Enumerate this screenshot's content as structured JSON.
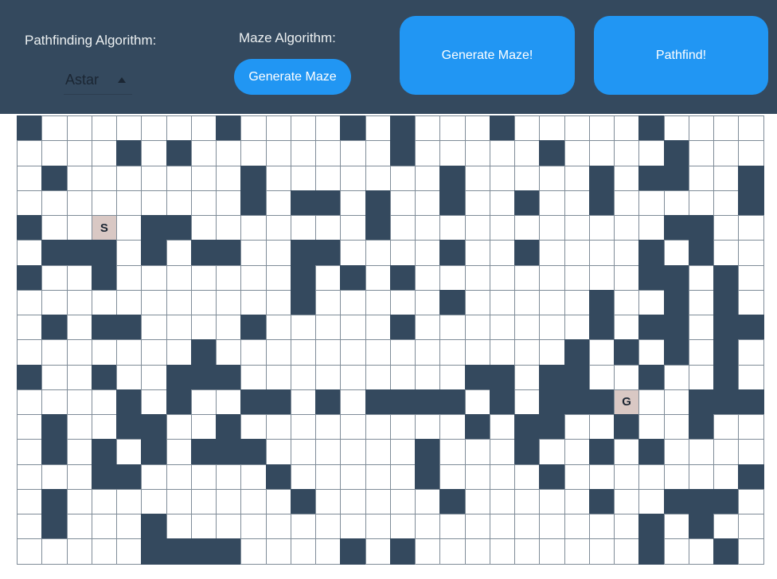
{
  "controls": {
    "pathfinding_label": "Pathfinding Algorithm:",
    "pathfinding_selected": "Astar",
    "maze_label": "Maze Algorithm:",
    "maze_button": "Generate Maze",
    "generate_button": "Generate Maze!",
    "pathfind_button": "Pathfind!"
  },
  "grid": {
    "cols": 30,
    "rows": 18,
    "start_label": "S",
    "goal_label": "G",
    "start": [
      3,
      4
    ],
    "goal": [
      24,
      11
    ],
    "walls": [
      "#.......#....#.#...#.....#....",
      "....#.#........#.....#....#...",
      ".#.......#.......#.....#.##..#",
      ".........#.##.#..#..#..#.....#",
      "#....##.......#...........##..",
      ".###.#.##..##....#..#....#.#..",
      "#..#.......#.#.#.........##.#.",
      "...........#.....#.....#..#.#.",
      ".#.##....#.....#.......#.##.##",
      ".......#..............#.#.#.#.",
      "#..#..###.........##.##..#..#.",
      "....#.#..##.#.####.#.###...###",
      ".#..##..#.........#.##..#..#..",
      ".#.#.#.###......#...#..#.#....",
      "...##.....#.....#....#.......#",
      ".#.........#.....#.....#..###.",
      ".#...#...................#.#..",
      ".....####....#.#.........#..#."
    ],
    "colors": {
      "wall": "#34495e",
      "open": "#ffffff",
      "marker": "#d9c8c4",
      "accent": "#2196f3"
    }
  }
}
